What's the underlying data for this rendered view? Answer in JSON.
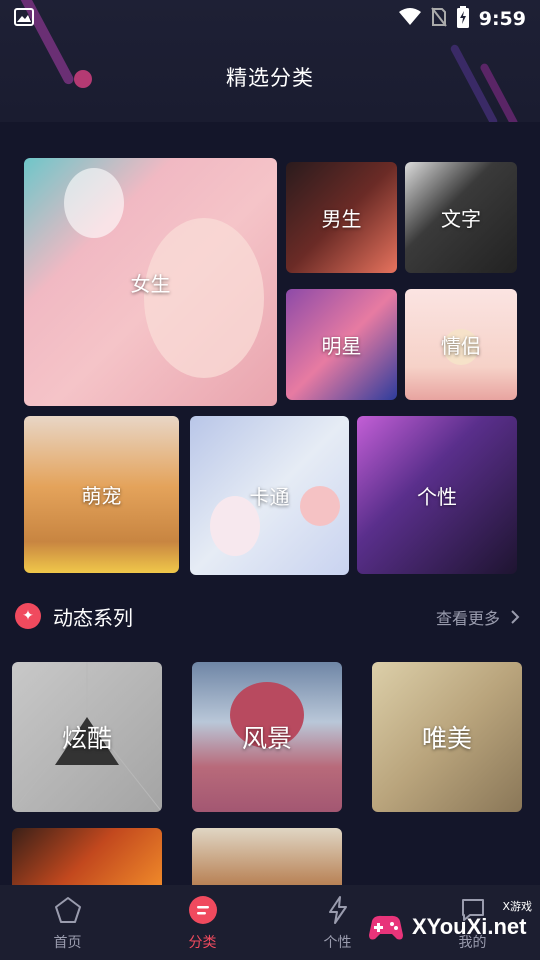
{
  "status_bar": {
    "time": "9:59"
  },
  "header": {
    "title": "精选分类"
  },
  "featured": {
    "tiles": [
      {
        "id": "nvsheng",
        "label": "女生"
      },
      {
        "id": "nansheng",
        "label": "男生"
      },
      {
        "id": "wenzi",
        "label": "文字"
      },
      {
        "id": "mingxing",
        "label": "明星"
      },
      {
        "id": "qinglv",
        "label": "情侣"
      },
      {
        "id": "mengchong",
        "label": "萌宠"
      },
      {
        "id": "katong",
        "label": "卡通"
      },
      {
        "id": "gexing",
        "label": "个性"
      }
    ]
  },
  "dynamic_section": {
    "title": "动态系列",
    "more_label": "查看更多",
    "tiles": [
      {
        "id": "xuanku",
        "label": "炫酷"
      },
      {
        "id": "fengjing",
        "label": "风景"
      },
      {
        "id": "weimei",
        "label": "唯美"
      }
    ]
  },
  "bottom_nav": {
    "items": [
      {
        "label": "首页",
        "icon": "pentagon-home-icon"
      },
      {
        "label": "分类",
        "icon": "category-icon",
        "active": true
      },
      {
        "label": "个性",
        "icon": "lightning-icon"
      },
      {
        "label": "我的",
        "icon": "chat-icon"
      }
    ]
  },
  "watermark": {
    "text": "XYouXi.net",
    "small": "X游戏"
  },
  "colors": {
    "accent": "#f04a5e",
    "background": "#14162a",
    "nav_bg": "#1c1e30"
  }
}
